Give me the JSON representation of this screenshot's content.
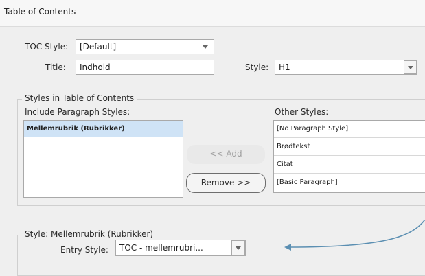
{
  "window": {
    "title": "Table of Contents"
  },
  "toc": {
    "style_label": "TOC Style:",
    "style_value": "[Default]",
    "title_label": "Title:",
    "title_value": "Indhold",
    "style2_label": "Style:",
    "style2_value": "H1"
  },
  "styles_group": {
    "title": "Styles in Table of Contents",
    "include_label": "Include Paragraph Styles:",
    "include_items": [
      "Mellemrubrik (Rubrikker)"
    ],
    "other_label": "Other Styles:",
    "other_items": [
      "[No Paragraph Style]",
      "Brødtekst",
      "Citat",
      "[Basic Paragraph]"
    ],
    "add_button": "<< Add",
    "remove_button": "Remove >>"
  },
  "style_group": {
    "title": "Style: Mellemrubrik (Rubrikker)",
    "entry_label": "Entry Style:",
    "entry_value": "TOC - mellemrubri..."
  },
  "colors": {
    "arrow": "#5b8fb2",
    "selection": "#cfe3f6"
  },
  "icons": {
    "dropdown": "chevron-down-icon",
    "annotation": "arrow-left-icon"
  }
}
